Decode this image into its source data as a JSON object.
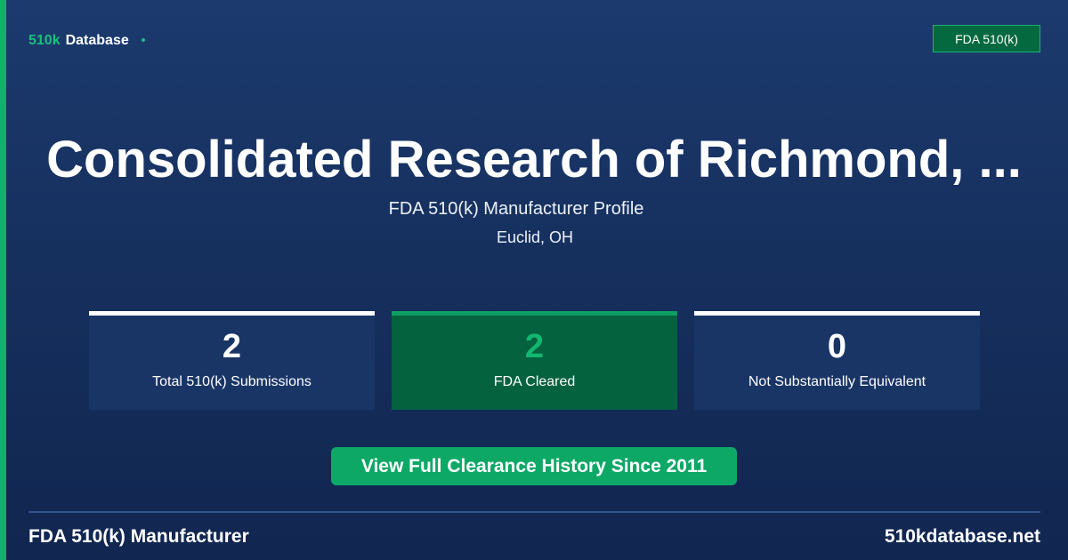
{
  "brand": {
    "accent": "510k",
    "rest": "Database"
  },
  "badge": "FDA 510(k)",
  "title": "Consolidated Research of Richmond, ...",
  "subtitle": "FDA 510(k) Manufacturer Profile",
  "location": "Euclid, OH",
  "stats": [
    {
      "value": "2",
      "label": "Total 510(k) Submissions"
    },
    {
      "value": "2",
      "label": "FDA Cleared"
    },
    {
      "value": "0",
      "label": "Not Substantially Equivalent"
    }
  ],
  "cta": "View Full Clearance History Since 2011",
  "footer": {
    "left": "FDA 510(k) Manufacturer",
    "right": "510kdatabase.net"
  },
  "colors": {
    "accent": "#10b06e",
    "background": "#16305e",
    "highlight_card": "#04623f"
  }
}
